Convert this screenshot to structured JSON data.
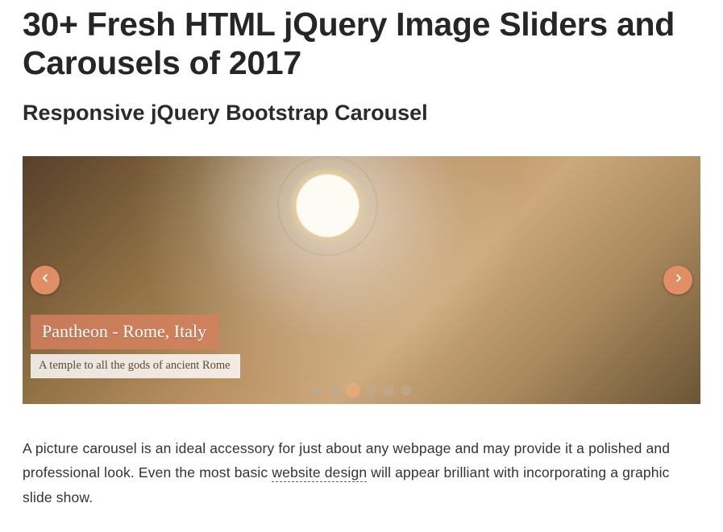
{
  "page": {
    "title": "30+ Fresh HTML jQuery Image Sliders and Carousels of 2017",
    "subtitle": "Responsive jQuery Bootstrap Carousel"
  },
  "carousel": {
    "caption_title": "Pantheon - Rome, Italy",
    "caption_sub": "A temple to all the gods of ancient Rome",
    "slide_count": 6,
    "active_index": 2
  },
  "body": {
    "text_before_link": "A picture carousel is an ideal accessory for just about any webpage and may provide it a polished and professional look. Even the most basic ",
    "link_text": "website design",
    "text_after_link": " will appear brilliant with incorporating a graphic slide show."
  }
}
